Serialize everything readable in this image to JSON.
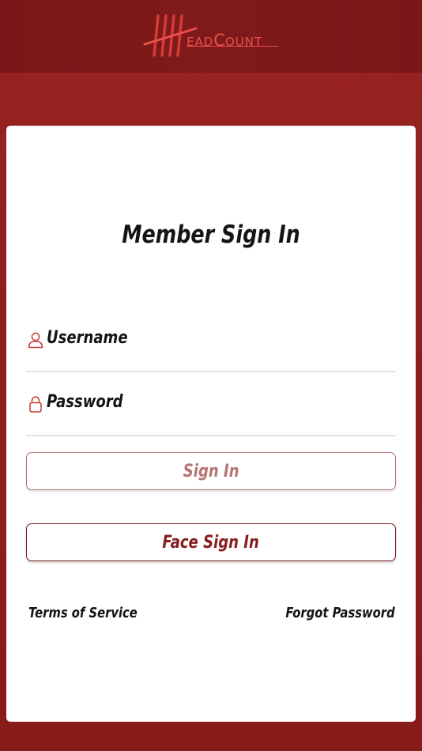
{
  "brand": {
    "logo_text": "HeadCount",
    "logo_initial_1": "H",
    "logo_rest_1": "EAD",
    "logo_initial_2": "C",
    "logo_rest_2": "OUNT",
    "accent_color": "#e8514a"
  },
  "colors": {
    "header_bg": "#7a1718",
    "page_bg": "#8f1f1d",
    "card_bg": "#ffffff",
    "sign_in_button_text": "#b47473",
    "face_sign_in_button_text": "#861c1e"
  },
  "login": {
    "title": "Member Sign In",
    "username": {
      "icon": "user-icon",
      "label": "Username",
      "value": ""
    },
    "password": {
      "icon": "lock-icon",
      "label": "Password",
      "value": ""
    },
    "sign_in_label": "Sign In",
    "face_sign_in_label": "Face Sign In"
  },
  "footer_links": {
    "terms": "Terms of Service",
    "forgot_password": "Forgot Password"
  }
}
